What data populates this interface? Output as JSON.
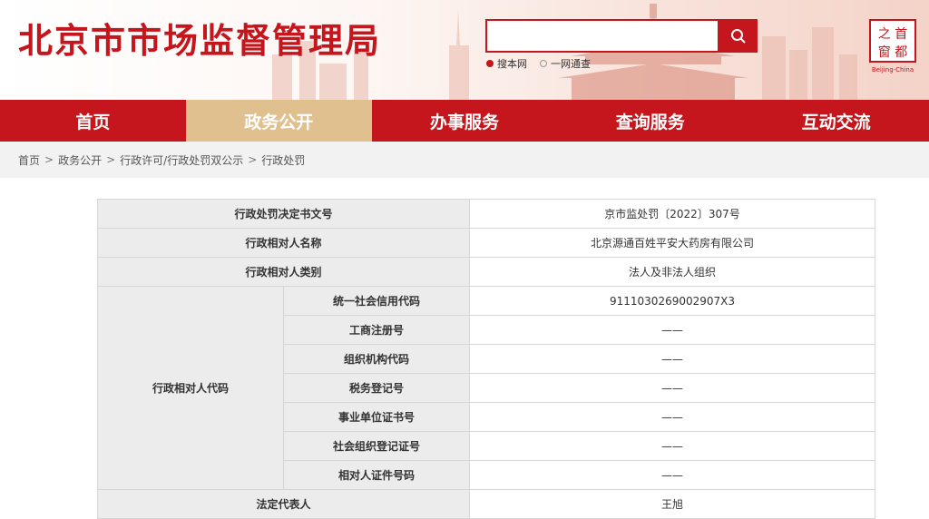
{
  "header": {
    "site_title": "北京市市场监督管理局",
    "search": {
      "value": "",
      "placeholder": ""
    },
    "scope_options": [
      "搜本网",
      "一网通查"
    ],
    "logo": {
      "line1": "首都之窗",
      "caption": "Beijing-China"
    }
  },
  "nav": [
    {
      "label": "首页",
      "active": false
    },
    {
      "label": "政务公开",
      "active": true
    },
    {
      "label": "办事服务",
      "active": false
    },
    {
      "label": "查询服务",
      "active": false
    },
    {
      "label": "互动交流",
      "active": false
    }
  ],
  "breadcrumb": [
    "首页",
    "政务公开",
    "行政许可/行政处罚双公示",
    "行政处罚"
  ],
  "breadcrumb_separator": ">",
  "colors": {
    "brand_red": "#c4161c",
    "nav_active": "#e0c08e"
  },
  "table": {
    "rows": [
      {
        "label": "行政处罚决定书文号",
        "value": "京市监处罚〔2022〕307号"
      },
      {
        "label": "行政相对人名称",
        "value": "北京源通百姓平安大药房有限公司"
      },
      {
        "label": "行政相对人类别",
        "value": "法人及非法人组织"
      }
    ],
    "code_group_label": "行政相对人代码",
    "code_rows": [
      {
        "label": "统一社会信用代码",
        "value": "9111030269002907X3"
      },
      {
        "label": "工商注册号",
        "value": "——"
      },
      {
        "label": "组织机构代码",
        "value": "——"
      },
      {
        "label": "税务登记号",
        "value": "——"
      },
      {
        "label": "事业单位证书号",
        "value": "——"
      },
      {
        "label": "社会组织登记证号",
        "value": "——"
      },
      {
        "label": "相对人证件号码",
        "value": "——"
      }
    ],
    "legal_rep": {
      "label": "法定代表人",
      "value": "王旭"
    }
  }
}
